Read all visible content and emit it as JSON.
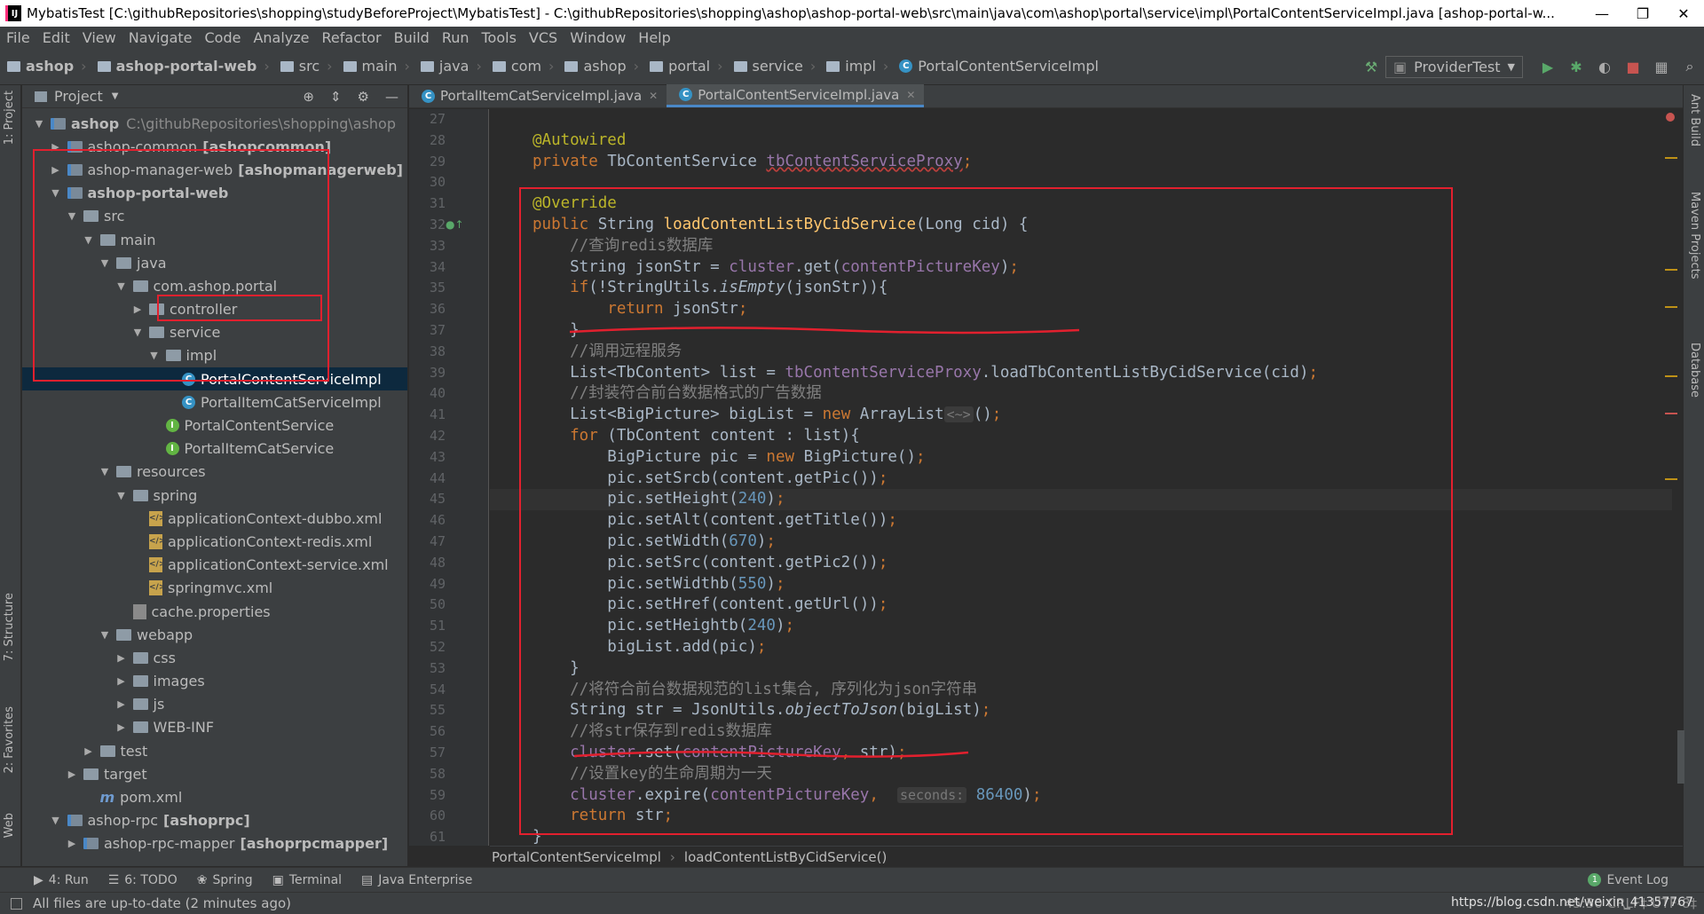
{
  "window": {
    "title": "MybatisTest [C:\\githubRepositories\\shopping\\studyBeforeProject\\MybatisTest] - C:\\githubRepositories\\shopping\\ashop\\ashop-portal-web\\src\\main\\java\\com\\ashop\\portal\\service\\impl\\PortalContentServiceImpl.java [ashop-portal-w...",
    "app_icon": "IJ",
    "minimize": "—",
    "restore": "❐",
    "close": "✕"
  },
  "menu": [
    "File",
    "Edit",
    "View",
    "Navigate",
    "Code",
    "Analyze",
    "Refactor",
    "Build",
    "Run",
    "Tools",
    "VCS",
    "Window",
    "Help"
  ],
  "nav": {
    "crumbs": [
      "ashop",
      "ashop-portal-web",
      "src",
      "main",
      "java",
      "com",
      "ashop",
      "portal",
      "service",
      "impl"
    ],
    "file": "PortalContentServiceImpl",
    "run_config": "ProviderTest"
  },
  "left_strip": {
    "project": "1: Project",
    "structure": "7: Structure",
    "favorites": "2: Favorites",
    "web": "Web"
  },
  "right_strip": {
    "ant": "Ant Build",
    "maven": "Maven Projects",
    "database": "Database"
  },
  "project": {
    "header": "Project",
    "tree": [
      {
        "label": "ashop",
        "extra": "C:\\githubRepositories\\shopping\\ashop",
        "depth": 0,
        "arrow": "▼",
        "type": "module"
      },
      {
        "label": "ashop-common",
        "extra": "[ashopcommon]",
        "depth": 1,
        "arrow": "▶",
        "type": "module"
      },
      {
        "label": "ashop-manager-web",
        "extra": "[ashopmanagerweb]",
        "depth": 1,
        "arrow": "▶",
        "type": "module"
      },
      {
        "label": "ashop-portal-web",
        "extra": "",
        "depth": 1,
        "arrow": "▼",
        "type": "module",
        "bold": true
      },
      {
        "label": "src",
        "extra": "",
        "depth": 2,
        "arrow": "▼",
        "type": "folder"
      },
      {
        "label": "main",
        "extra": "",
        "depth": 3,
        "arrow": "▼",
        "type": "folder"
      },
      {
        "label": "java",
        "extra": "",
        "depth": 4,
        "arrow": "▼",
        "type": "folder"
      },
      {
        "label": "com.ashop.portal",
        "extra": "",
        "depth": 5,
        "arrow": "▼",
        "type": "folder"
      },
      {
        "label": "controller",
        "extra": "",
        "depth": 6,
        "arrow": "▶",
        "type": "folder"
      },
      {
        "label": "service",
        "extra": "",
        "depth": 6,
        "arrow": "▼",
        "type": "folder"
      },
      {
        "label": "impl",
        "extra": "",
        "depth": 7,
        "arrow": "▼",
        "type": "folder"
      },
      {
        "label": "PortalContentServiceImpl",
        "extra": "",
        "depth": 8,
        "arrow": "",
        "type": "class",
        "selected": true
      },
      {
        "label": "PortalItemCatServiceImpl",
        "extra": "",
        "depth": 8,
        "arrow": "",
        "type": "class"
      },
      {
        "label": "PortalContentService",
        "extra": "",
        "depth": 7,
        "arrow": "",
        "type": "interface"
      },
      {
        "label": "PortalItemCatService",
        "extra": "",
        "depth": 7,
        "arrow": "",
        "type": "interface"
      },
      {
        "label": "resources",
        "extra": "",
        "depth": 4,
        "arrow": "▼",
        "type": "folder"
      },
      {
        "label": "spring",
        "extra": "",
        "depth": 5,
        "arrow": "▼",
        "type": "folder"
      },
      {
        "label": "applicationContext-dubbo.xml",
        "extra": "",
        "depth": 6,
        "arrow": "",
        "type": "xml"
      },
      {
        "label": "applicationContext-redis.xml",
        "extra": "",
        "depth": 6,
        "arrow": "",
        "type": "xml"
      },
      {
        "label": "applicationContext-service.xml",
        "extra": "",
        "depth": 6,
        "arrow": "",
        "type": "xml"
      },
      {
        "label": "springmvc.xml",
        "extra": "",
        "depth": 6,
        "arrow": "",
        "type": "xml"
      },
      {
        "label": "cache.properties",
        "extra": "",
        "depth": 5,
        "arrow": "",
        "type": "props"
      },
      {
        "label": "webapp",
        "extra": "",
        "depth": 4,
        "arrow": "▼",
        "type": "folder"
      },
      {
        "label": "css",
        "extra": "",
        "depth": 5,
        "arrow": "▶",
        "type": "folder"
      },
      {
        "label": "images",
        "extra": "",
        "depth": 5,
        "arrow": "▶",
        "type": "folder"
      },
      {
        "label": "js",
        "extra": "",
        "depth": 5,
        "arrow": "▶",
        "type": "folder"
      },
      {
        "label": "WEB-INF",
        "extra": "",
        "depth": 5,
        "arrow": "▶",
        "type": "folder"
      },
      {
        "label": "test",
        "extra": "",
        "depth": 3,
        "arrow": "▶",
        "type": "folder"
      },
      {
        "label": "target",
        "extra": "",
        "depth": 2,
        "arrow": "▶",
        "type": "folder"
      },
      {
        "label": "pom.xml",
        "extra": "",
        "depth": 3,
        "arrow": "",
        "type": "maven"
      },
      {
        "label": "ashop-rpc",
        "extra": "[ashoprpc]",
        "depth": 1,
        "arrow": "▼",
        "type": "module"
      },
      {
        "label": "ashop-rpc-mapper",
        "extra": "[ashoprpcmapper]",
        "depth": 2,
        "arrow": "▶",
        "type": "module"
      }
    ]
  },
  "editor": {
    "tabs": [
      {
        "label": "PortalItemCatServiceImpl.java",
        "active": false
      },
      {
        "label": "PortalContentServiceImpl.java",
        "active": true
      }
    ],
    "line_numbers": [
      "27",
      "28",
      "29",
      "30",
      "31",
      "32",
      "33",
      "34",
      "35",
      "36",
      "37",
      "38",
      "39",
      "40",
      "41",
      "42",
      "43",
      "44",
      "45",
      "46",
      "47",
      "48",
      "49",
      "50",
      "51",
      "52",
      "53",
      "54",
      "55",
      "56",
      "57",
      "58",
      "59",
      "60",
      "61"
    ],
    "lines": [
      [],
      [
        {
          "c": "ann",
          "t": "@Autowired"
        }
      ],
      [
        {
          "c": "kw",
          "t": "private "
        },
        {
          "c": "",
          "t": "TbContentService "
        },
        {
          "c": "fld wavy",
          "t": "tbContentServiceProxy"
        },
        {
          "c": "kw",
          "t": ";"
        }
      ],
      [],
      [
        {
          "c": "ann",
          "t": "@Override"
        }
      ],
      [
        {
          "c": "kw",
          "t": "public "
        },
        {
          "c": "",
          "t": "String "
        },
        {
          "c": "fn",
          "t": "loadContentListByCidService"
        },
        {
          "c": "",
          "t": "(Long cid) {"
        }
      ],
      [
        {
          "c": "cm",
          "t": "    //查询redis数据库"
        }
      ],
      [
        {
          "c": "",
          "t": "    String jsonStr = "
        },
        {
          "c": "fld",
          "t": "cluster"
        },
        {
          "c": "",
          "t": ".get("
        },
        {
          "c": "fld",
          "t": "contentPictureKey"
        },
        {
          "c": "",
          "t": ")"
        },
        {
          "c": "kw",
          "t": ";"
        }
      ],
      [
        {
          "c": "kw",
          "t": "    if"
        },
        {
          "c": "",
          "t": "(!StringUtils."
        },
        {
          "c": "it",
          "t": "isEmpty"
        },
        {
          "c": "",
          "t": "(jsonStr)){"
        }
      ],
      [
        {
          "c": "kw",
          "t": "        return "
        },
        {
          "c": "",
          "t": "jsonStr"
        },
        {
          "c": "kw",
          "t": ";"
        }
      ],
      [
        {
          "c": "",
          "t": "    }"
        }
      ],
      [
        {
          "c": "cm",
          "t": "    //调用远程服务"
        }
      ],
      [
        {
          "c": "",
          "t": "    List<TbContent> list = "
        },
        {
          "c": "fld",
          "t": "tbContentServiceProxy"
        },
        {
          "c": "",
          "t": ".loadTbContentListByCidService(cid)"
        },
        {
          "c": "kw",
          "t": ";"
        }
      ],
      [
        {
          "c": "cm",
          "t": "    //封装符合前台数据格式的广告数据"
        }
      ],
      [
        {
          "c": "",
          "t": "    List<BigPicture> bigList = "
        },
        {
          "c": "kw",
          "t": "new "
        },
        {
          "c": "",
          "t": "ArrayList"
        },
        {
          "c": "hint",
          "t": "<~>"
        },
        {
          "c": "",
          "t": "()"
        },
        {
          "c": "kw",
          "t": ";"
        }
      ],
      [
        {
          "c": "kw",
          "t": "    for "
        },
        {
          "c": "",
          "t": "(TbContent content : list){"
        }
      ],
      [
        {
          "c": "",
          "t": "        BigPicture pic = "
        },
        {
          "c": "kw",
          "t": "new "
        },
        {
          "c": "",
          "t": "BigPicture()"
        },
        {
          "c": "kw",
          "t": ";"
        }
      ],
      [
        {
          "c": "",
          "t": "        pic.setSrcb(content.getPic())"
        },
        {
          "c": "kw",
          "t": ";"
        }
      ],
      [
        {
          "c": "",
          "t": "        pic.setHeight("
        },
        {
          "c": "num",
          "t": "240"
        },
        {
          "c": "",
          "t": ")"
        },
        {
          "c": "kw",
          "t": ";"
        }
      ],
      [
        {
          "c": "",
          "t": "        pic.setAlt(content.getTitle())"
        },
        {
          "c": "kw",
          "t": ";"
        }
      ],
      [
        {
          "c": "",
          "t": "        pic.setWidth("
        },
        {
          "c": "num",
          "t": "670"
        },
        {
          "c": "",
          "t": ")"
        },
        {
          "c": "kw",
          "t": ";"
        }
      ],
      [
        {
          "c": "",
          "t": "        pic.setSrc(content.getPic2())"
        },
        {
          "c": "kw",
          "t": ";"
        }
      ],
      [
        {
          "c": "",
          "t": "        pic.setWidthb("
        },
        {
          "c": "num",
          "t": "550"
        },
        {
          "c": "",
          "t": ")"
        },
        {
          "c": "kw",
          "t": ";"
        }
      ],
      [
        {
          "c": "",
          "t": "        pic.setHref(content.getUrl())"
        },
        {
          "c": "kw",
          "t": ";"
        }
      ],
      [
        {
          "c": "",
          "t": "        pic.setHeightb("
        },
        {
          "c": "num",
          "t": "240"
        },
        {
          "c": "",
          "t": ")"
        },
        {
          "c": "kw",
          "t": ";"
        }
      ],
      [
        {
          "c": "",
          "t": "        bigList.add(pic)"
        },
        {
          "c": "kw",
          "t": ";"
        }
      ],
      [
        {
          "c": "",
          "t": "    }"
        }
      ],
      [
        {
          "c": "cm",
          "t": "    //将符合前台数据规范的list集合, 序列化为json字符串"
        }
      ],
      [
        {
          "c": "",
          "t": "    String str = JsonUtils."
        },
        {
          "c": "it",
          "t": "objectToJson"
        },
        {
          "c": "",
          "t": "(bigList)"
        },
        {
          "c": "kw",
          "t": ";"
        }
      ],
      [
        {
          "c": "cm",
          "t": "    //将str保存到redis数据库"
        }
      ],
      [
        {
          "c": "fld",
          "t": "    cluster"
        },
        {
          "c": "",
          "t": ".set("
        },
        {
          "c": "fld",
          "t": "contentPictureKey"
        },
        {
          "c": "kw",
          "t": ", "
        },
        {
          "c": "",
          "t": "str)"
        },
        {
          "c": "kw",
          "t": ";"
        }
      ],
      [
        {
          "c": "cm",
          "t": "    //设置key的生命周期为一天"
        }
      ],
      [
        {
          "c": "fld",
          "t": "    cluster"
        },
        {
          "c": "",
          "t": ".expire("
        },
        {
          "c": "fld",
          "t": "contentPictureKey"
        },
        {
          "c": "kw",
          "t": ",  "
        },
        {
          "c": "hint",
          "t": "seconds:"
        },
        {
          "c": "num",
          "t": " 86400"
        },
        {
          "c": "",
          "t": ")"
        },
        {
          "c": "kw",
          "t": ";"
        }
      ],
      [
        {
          "c": "kw",
          "t": "    return "
        },
        {
          "c": "",
          "t": "str"
        },
        {
          "c": "kw",
          "t": ";"
        }
      ],
      [
        {
          "c": "",
          "t": "}"
        }
      ]
    ],
    "breadcrumb": [
      "PortalContentServiceImpl",
      "loadContentListByCidService()"
    ]
  },
  "toolwindows": [
    {
      "label": "4: Run",
      "icon": "▶"
    },
    {
      "label": "6: TODO",
      "icon": "☰"
    },
    {
      "label": "Spring",
      "icon": "❀"
    },
    {
      "label": "Terminal",
      "icon": "▣"
    },
    {
      "label": "Java Enterprise",
      "icon": "▤"
    }
  ],
  "event_log": "Event Log",
  "event_count": "1",
  "status": {
    "message": "All files are up-to-date (2 minutes ago)",
    "right": "45:30  CRLF‡  UTF-8‡",
    "watermark": "https://blog.csdn.net/weixin_41357767"
  }
}
